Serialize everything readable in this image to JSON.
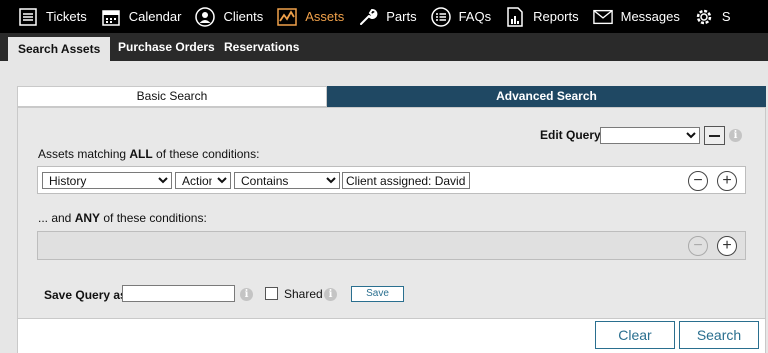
{
  "nav": {
    "items": [
      {
        "label": "Tickets",
        "icon": "list-icon"
      },
      {
        "label": "Calendar",
        "icon": "calendar-icon"
      },
      {
        "label": "Clients",
        "icon": "person-icon"
      },
      {
        "label": "Assets",
        "icon": "chart-icon",
        "active": true
      },
      {
        "label": "Parts",
        "icon": "wrench-icon"
      },
      {
        "label": "FAQs",
        "icon": "faq-icon"
      },
      {
        "label": "Reports",
        "icon": "report-icon"
      },
      {
        "label": "Messages",
        "icon": "mail-icon"
      },
      {
        "label": "S",
        "icon": "gear-icon"
      }
    ],
    "active_color": "#f0a14a"
  },
  "subnav": {
    "tabs": [
      "Search Assets",
      "Purchase Orders",
      "Reservations"
    ]
  },
  "search_tabs": {
    "basic": "Basic Search",
    "advanced": "Advanced Search"
  },
  "edit_query": {
    "label": "Edit Query",
    "value": ""
  },
  "all_conditions": {
    "prefix": "Assets matching ",
    "emphasis": "ALL",
    "suffix": " of these conditions:",
    "row": {
      "field": "History",
      "subfield": "Action",
      "operator": "Contains",
      "value": "Client assigned: David Tr"
    }
  },
  "any_conditions": {
    "prefix": "... and ",
    "emphasis": "ANY",
    "suffix": " of these conditions:"
  },
  "save_query": {
    "label": "Save Query as",
    "value": "",
    "shared_label": "Shared",
    "save_button": "Save"
  },
  "footer": {
    "clear": "Clear",
    "search": "Search"
  },
  "colors": {
    "advanced_tab_bg": "#1f4863",
    "button_border": "#2a6f8f"
  }
}
